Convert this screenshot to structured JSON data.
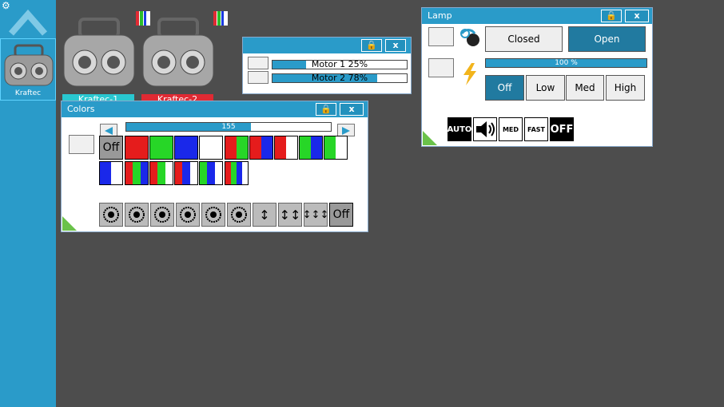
{
  "sidebar": {
    "fixture_name": "Kraftec"
  },
  "fixtures": [
    {
      "label": "Kraftec-1",
      "color": "#29c7d0"
    },
    {
      "label": "Kraftec-2",
      "color": "#e02a33"
    }
  ],
  "motor_window": {
    "motors": [
      {
        "text": "Motor 1    25%",
        "value": 25
      },
      {
        "text": "Motor 2    78%",
        "value": 78
      }
    ]
  },
  "colors_window": {
    "title": "Colors",
    "slider_text": "155",
    "slider_value": 155,
    "slider_max": 255,
    "off_label": "Off",
    "ctrl_off_label": "Off"
  },
  "lamp_window": {
    "title": "Lamp",
    "closed_label": "Closed",
    "open_label": "Open",
    "level_text": "100 %",
    "level_value": 100,
    "modes": [
      "Off",
      "Low",
      "Med",
      "High"
    ],
    "icons": {
      "auto": "AUTO",
      "med": "MED",
      "fast": "FAST",
      "off": "OFF"
    }
  },
  "colors": {
    "accent": "#2a9bc9",
    "background": "#4d4d4d"
  }
}
